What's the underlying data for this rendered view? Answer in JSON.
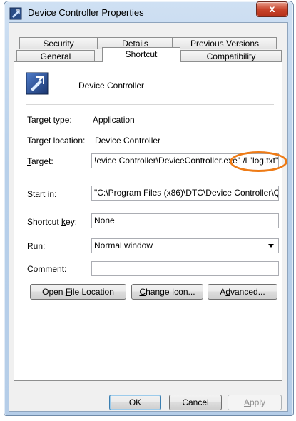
{
  "window": {
    "title": "Device Controller Properties",
    "close_label": "x"
  },
  "tabs": {
    "row1": [
      {
        "label": "Security"
      },
      {
        "label": "Details"
      },
      {
        "label": "Previous Versions"
      }
    ],
    "row2": [
      {
        "label": "General"
      },
      {
        "label": "Shortcut"
      },
      {
        "label": "Compatibility"
      }
    ],
    "active": "Shortcut"
  },
  "shortcut": {
    "app_name": "Device Controller",
    "target_type_label": "Target type:",
    "target_type_value": "Application",
    "target_location_label": "Target location:",
    "target_location_value": "Device Controller",
    "target_label_accel": "T",
    "target_label_rest": "arget:",
    "target_value": "!evice Controller\\DeviceController.exe\" /l \"log.txt\"",
    "start_in_label_accel": "S",
    "start_in_label_rest": "tart in:",
    "start_in_value": "\"C:\\Program Files (x86)\\DTC\\Device Controller\\Q",
    "shortcut_key_label_pre": "Shortcut ",
    "shortcut_key_label_accel": "k",
    "shortcut_key_label_rest": "ey:",
    "shortcut_key_value": "None",
    "run_label_accel": "R",
    "run_label_rest": "un:",
    "run_value": "Normal window",
    "comment_label_pre": "C",
    "comment_label_accel": "o",
    "comment_label_rest": "mment:",
    "comment_value": ""
  },
  "actions": {
    "open_file_location_pre": "Open ",
    "open_file_location_accel": "F",
    "open_file_location_rest": "ile Location",
    "change_icon_accel": "C",
    "change_icon_rest": "hange Icon...",
    "advanced_pre": "A",
    "advanced_accel": "d",
    "advanced_rest": "vanced..."
  },
  "footer": {
    "ok_label": "OK",
    "cancel_label": "Cancel",
    "apply_label_accel": "A",
    "apply_label_rest": "pply"
  },
  "colors": {
    "highlight_ring": "#ee7b16",
    "title_bar": "#b8d0ea",
    "close_button": "#c9462d"
  }
}
